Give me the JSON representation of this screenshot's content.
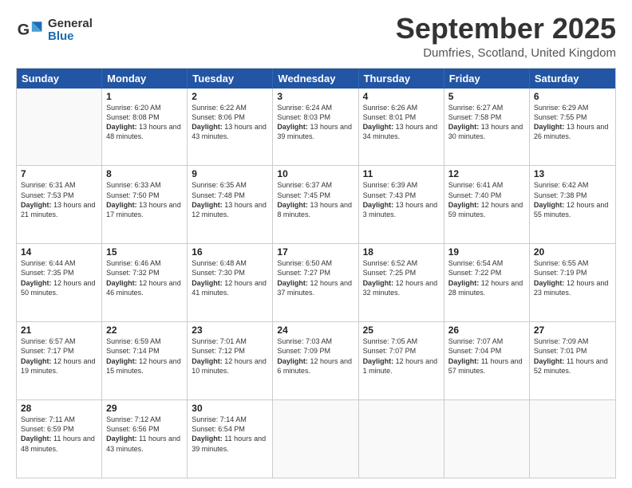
{
  "header": {
    "logo": {
      "general": "General",
      "blue": "Blue"
    },
    "title": "September 2025",
    "location": "Dumfries, Scotland, United Kingdom"
  },
  "weekdays": [
    "Sunday",
    "Monday",
    "Tuesday",
    "Wednesday",
    "Thursday",
    "Friday",
    "Saturday"
  ],
  "rows": [
    [
      {
        "day": "",
        "sunrise": "",
        "sunset": "",
        "daylight": ""
      },
      {
        "day": "1",
        "sunrise": "Sunrise: 6:20 AM",
        "sunset": "Sunset: 8:08 PM",
        "daylight": "Daylight: 13 hours and 48 minutes."
      },
      {
        "day": "2",
        "sunrise": "Sunrise: 6:22 AM",
        "sunset": "Sunset: 8:06 PM",
        "daylight": "Daylight: 13 hours and 43 minutes."
      },
      {
        "day": "3",
        "sunrise": "Sunrise: 6:24 AM",
        "sunset": "Sunset: 8:03 PM",
        "daylight": "Daylight: 13 hours and 39 minutes."
      },
      {
        "day": "4",
        "sunrise": "Sunrise: 6:26 AM",
        "sunset": "Sunset: 8:01 PM",
        "daylight": "Daylight: 13 hours and 34 minutes."
      },
      {
        "day": "5",
        "sunrise": "Sunrise: 6:27 AM",
        "sunset": "Sunset: 7:58 PM",
        "daylight": "Daylight: 13 hours and 30 minutes."
      },
      {
        "day": "6",
        "sunrise": "Sunrise: 6:29 AM",
        "sunset": "Sunset: 7:55 PM",
        "daylight": "Daylight: 13 hours and 26 minutes."
      }
    ],
    [
      {
        "day": "7",
        "sunrise": "Sunrise: 6:31 AM",
        "sunset": "Sunset: 7:53 PM",
        "daylight": "Daylight: 13 hours and 21 minutes."
      },
      {
        "day": "8",
        "sunrise": "Sunrise: 6:33 AM",
        "sunset": "Sunset: 7:50 PM",
        "daylight": "Daylight: 13 hours and 17 minutes."
      },
      {
        "day": "9",
        "sunrise": "Sunrise: 6:35 AM",
        "sunset": "Sunset: 7:48 PM",
        "daylight": "Daylight: 13 hours and 12 minutes."
      },
      {
        "day": "10",
        "sunrise": "Sunrise: 6:37 AM",
        "sunset": "Sunset: 7:45 PM",
        "daylight": "Daylight: 13 hours and 8 minutes."
      },
      {
        "day": "11",
        "sunrise": "Sunrise: 6:39 AM",
        "sunset": "Sunset: 7:43 PM",
        "daylight": "Daylight: 13 hours and 3 minutes."
      },
      {
        "day": "12",
        "sunrise": "Sunrise: 6:41 AM",
        "sunset": "Sunset: 7:40 PM",
        "daylight": "Daylight: 12 hours and 59 minutes."
      },
      {
        "day": "13",
        "sunrise": "Sunrise: 6:42 AM",
        "sunset": "Sunset: 7:38 PM",
        "daylight": "Daylight: 12 hours and 55 minutes."
      }
    ],
    [
      {
        "day": "14",
        "sunrise": "Sunrise: 6:44 AM",
        "sunset": "Sunset: 7:35 PM",
        "daylight": "Daylight: 12 hours and 50 minutes."
      },
      {
        "day": "15",
        "sunrise": "Sunrise: 6:46 AM",
        "sunset": "Sunset: 7:32 PM",
        "daylight": "Daylight: 12 hours and 46 minutes."
      },
      {
        "day": "16",
        "sunrise": "Sunrise: 6:48 AM",
        "sunset": "Sunset: 7:30 PM",
        "daylight": "Daylight: 12 hours and 41 minutes."
      },
      {
        "day": "17",
        "sunrise": "Sunrise: 6:50 AM",
        "sunset": "Sunset: 7:27 PM",
        "daylight": "Daylight: 12 hours and 37 minutes."
      },
      {
        "day": "18",
        "sunrise": "Sunrise: 6:52 AM",
        "sunset": "Sunset: 7:25 PM",
        "daylight": "Daylight: 12 hours and 32 minutes."
      },
      {
        "day": "19",
        "sunrise": "Sunrise: 6:54 AM",
        "sunset": "Sunset: 7:22 PM",
        "daylight": "Daylight: 12 hours and 28 minutes."
      },
      {
        "day": "20",
        "sunrise": "Sunrise: 6:55 AM",
        "sunset": "Sunset: 7:19 PM",
        "daylight": "Daylight: 12 hours and 23 minutes."
      }
    ],
    [
      {
        "day": "21",
        "sunrise": "Sunrise: 6:57 AM",
        "sunset": "Sunset: 7:17 PM",
        "daylight": "Daylight: 12 hours and 19 minutes."
      },
      {
        "day": "22",
        "sunrise": "Sunrise: 6:59 AM",
        "sunset": "Sunset: 7:14 PM",
        "daylight": "Daylight: 12 hours and 15 minutes."
      },
      {
        "day": "23",
        "sunrise": "Sunrise: 7:01 AM",
        "sunset": "Sunset: 7:12 PM",
        "daylight": "Daylight: 12 hours and 10 minutes."
      },
      {
        "day": "24",
        "sunrise": "Sunrise: 7:03 AM",
        "sunset": "Sunset: 7:09 PM",
        "daylight": "Daylight: 12 hours and 6 minutes."
      },
      {
        "day": "25",
        "sunrise": "Sunrise: 7:05 AM",
        "sunset": "Sunset: 7:07 PM",
        "daylight": "Daylight: 12 hours and 1 minute."
      },
      {
        "day": "26",
        "sunrise": "Sunrise: 7:07 AM",
        "sunset": "Sunset: 7:04 PM",
        "daylight": "Daylight: 11 hours and 57 minutes."
      },
      {
        "day": "27",
        "sunrise": "Sunrise: 7:09 AM",
        "sunset": "Sunset: 7:01 PM",
        "daylight": "Daylight: 11 hours and 52 minutes."
      }
    ],
    [
      {
        "day": "28",
        "sunrise": "Sunrise: 7:11 AM",
        "sunset": "Sunset: 6:59 PM",
        "daylight": "Daylight: 11 hours and 48 minutes."
      },
      {
        "day": "29",
        "sunrise": "Sunrise: 7:12 AM",
        "sunset": "Sunset: 6:56 PM",
        "daylight": "Daylight: 11 hours and 43 minutes."
      },
      {
        "day": "30",
        "sunrise": "Sunrise: 7:14 AM",
        "sunset": "Sunset: 6:54 PM",
        "daylight": "Daylight: 11 hours and 39 minutes."
      },
      {
        "day": "",
        "sunrise": "",
        "sunset": "",
        "daylight": ""
      },
      {
        "day": "",
        "sunrise": "",
        "sunset": "",
        "daylight": ""
      },
      {
        "day": "",
        "sunrise": "",
        "sunset": "",
        "daylight": ""
      },
      {
        "day": "",
        "sunrise": "",
        "sunset": "",
        "daylight": ""
      }
    ]
  ]
}
